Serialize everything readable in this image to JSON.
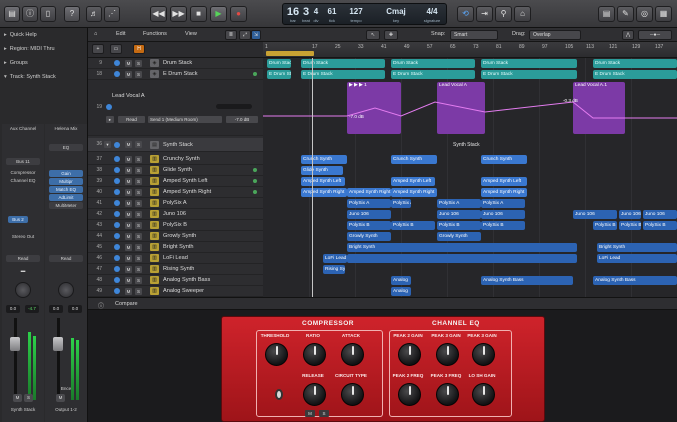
{
  "toolbar": {
    "buttons_left": [
      "▤",
      "ⓘ",
      "▯",
      "?",
      "♬",
      "⋰"
    ],
    "transport": [
      "◀◀",
      "▶▶",
      "■",
      "▶",
      "●"
    ],
    "lcd": {
      "bar": "16",
      "beat": "3",
      "div": "4",
      "tick": "61",
      "tempo": "127",
      "key": "Cmaj",
      "sig": "4/4",
      "labels": {
        "bar": "bar",
        "beat": "beat",
        "div": "div",
        "tick": "tick",
        "tempo": "tempo",
        "key": "key",
        "sig": "signature"
      }
    }
  },
  "inspector": {
    "items": [
      {
        "label": "Quick Help"
      },
      {
        "label": "Region: MIDI Thru"
      },
      {
        "label": "Groups"
      },
      {
        "label": "Track: Synth Stack"
      }
    ],
    "strip1": {
      "setting": "Aux Channel",
      "eq": "",
      "slots": [
        "Bus 11",
        "Compressor",
        "Channel EQ"
      ],
      "send": "Bus 2",
      "output": "Stereo Out",
      "automation": "Read",
      "pan_value": "0.0",
      "gain_value": "-4.7",
      "name": "Synth Stack"
    },
    "strip2": {
      "setting": "Helena Mix",
      "eq": "EQ",
      "slots": [
        "Gain",
        "Multipr",
        "Match EQ",
        "AdLimit",
        "MultiMeter"
      ],
      "automation": "Read",
      "pan_value": "0.0",
      "gain_value": "0.0",
      "name": "Output 1-2",
      "bounce": "Bnce"
    }
  },
  "tracks_toolbar": {
    "edit": "Edit",
    "functions": "Functions",
    "view": "View",
    "snap_label": "Snap:",
    "snap_value": "Smart",
    "drag_label": "Drag:",
    "drag_value": "Overlap"
  },
  "ruler": [
    "1",
    "17",
    "25",
    "33",
    "41",
    "49",
    "57",
    "65",
    "73",
    "81",
    "89",
    "97",
    "105",
    "113",
    "121",
    "129",
    "137"
  ],
  "tracks": [
    {
      "num": "9",
      "name": "Drum Stack"
    },
    {
      "num": "18",
      "name": "E Drum Stack"
    },
    {
      "num": "19",
      "name": "Lead Vocal A"
    },
    {
      "num": "36",
      "name": "Synth Stack"
    },
    {
      "num": "37",
      "name": "Crunchy Synth"
    },
    {
      "num": "38",
      "name": "Glide Synth"
    },
    {
      "num": "39",
      "name": "Amped Synth Left"
    },
    {
      "num": "40",
      "name": "Amped Synth Right"
    },
    {
      "num": "41",
      "name": "PolySix A"
    },
    {
      "num": "42",
      "name": "Juno 106"
    },
    {
      "num": "43",
      "name": "PolySix B"
    },
    {
      "num": "44",
      "name": "Growly Synth"
    },
    {
      "num": "45",
      "name": "Bright Synth"
    },
    {
      "num": "46",
      "name": "LoFi Lead"
    },
    {
      "num": "47",
      "name": "Rising Synth"
    },
    {
      "num": "48",
      "name": "Analog Synth Bass"
    },
    {
      "num": "49",
      "name": "Analog Sweeper"
    }
  ],
  "vocal_track": {
    "automation": "Read",
    "send": "Send 1 (Medium Room)",
    "value": "-7.0 dB",
    "regions": [
      "Lead Vocal A",
      "Lead Vocal A.1"
    ],
    "points": [
      "-7.0 dB",
      "-0.3 dB"
    ]
  },
  "regions": {
    "drum": [
      "Drum Stack",
      "Drum Stack",
      "Drum Stack",
      "Drum Stack"
    ],
    "edrum": [
      "E Drum Stack",
      "E Drum Stack",
      "E Drum Stack",
      "E Drum Stack"
    ],
    "synth_stack": "Synth Stack",
    "crunchy": "Crunch Synth",
    "glide": "Glide Synth",
    "amped_left": "Amped Synth Left",
    "amped_right": "Amped Synth Right",
    "polysix_a": "PolySix A",
    "juno": "Juno 106",
    "polysix_b": "PolySix B",
    "growly": "Growly Synth",
    "bright": "Bright Synth",
    "lofi": "LoFi Lead",
    "rising": "Rising Synth",
    "analog_bass": "Analog Synth Bass",
    "analog_sweep": "Analog"
  },
  "bottom": {
    "tab": "Compare",
    "plugin": {
      "compressor_title": "COMPRESSOR",
      "eq_title": "CHANNEL EQ",
      "knobs_comp": [
        "THRESHOLD",
        "RATIO",
        "ATTACK",
        "RELEASE",
        "CIRCUIT TYPE"
      ],
      "knobs_eq": [
        "PEAK 2 GAIN",
        "PEAK 3 GAIN",
        "PEAK 3 GAIN",
        "PEAK 2 FREQ",
        "PEAK 3 FREQ",
        "LO SH GAIN"
      ]
    }
  },
  "colors": {
    "accent": "#3a78d0",
    "region_cyan": "#2b9c9a",
    "region_purple": "#8d45b8",
    "plugin_red": "#cf232b"
  }
}
